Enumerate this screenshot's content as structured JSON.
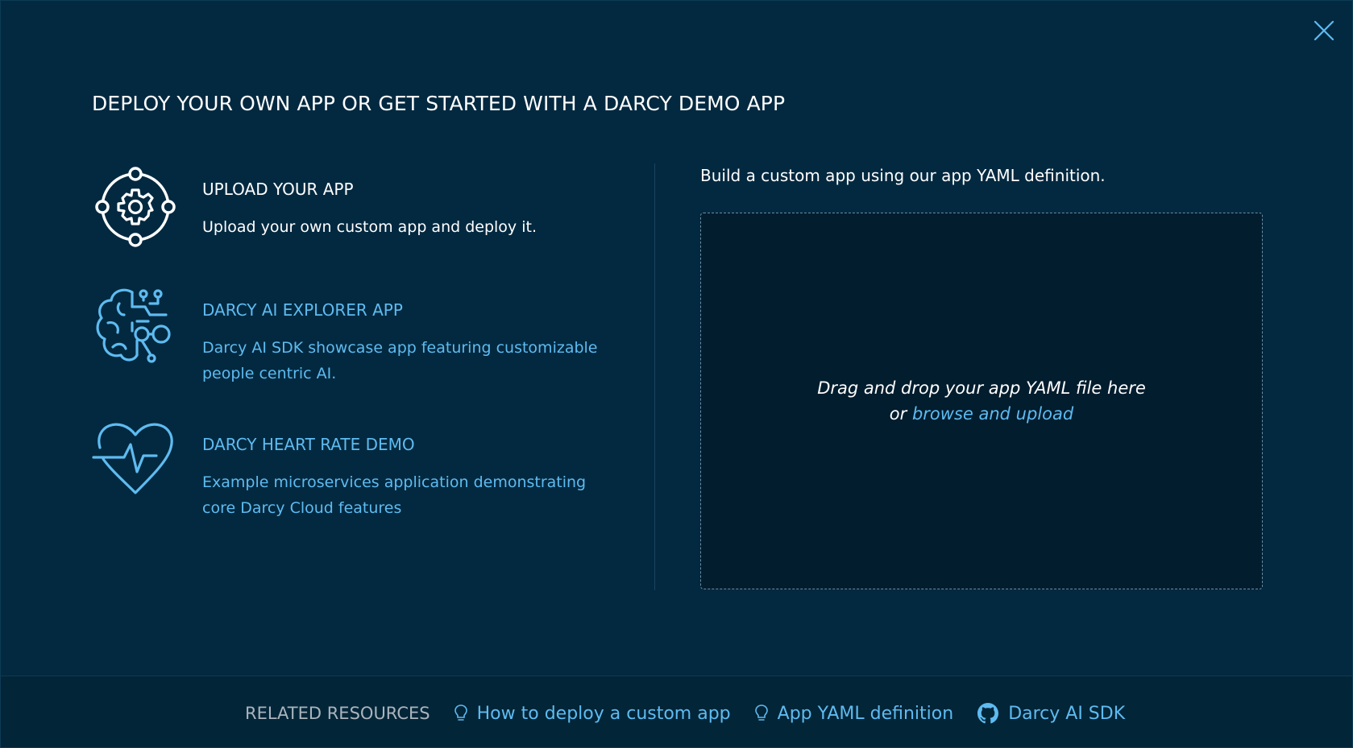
{
  "modal": {
    "title": "DEPLOY YOUR OWN APP OR GET STARTED WITH A DARCY DEMO APP",
    "close_icon": "close-icon"
  },
  "options": [
    {
      "icon": "gear-orbit-icon",
      "title": "UPLOAD YOUR APP",
      "description": "Upload your own custom app and deploy it."
    },
    {
      "icon": "brain-circuit-icon",
      "title": "DARCY AI EXPLORER APP",
      "description": "Darcy AI SDK showcase app featuring customizable people centric AI."
    },
    {
      "icon": "heart-rate-icon",
      "title": "DARCY HEART RATE DEMO",
      "description": "Example microservices application demonstrating core Darcy Cloud features"
    }
  ],
  "upload_panel": {
    "intro": "Build a custom app using our app YAML definition.",
    "dropzone_line1": "Drag and drop your app YAML file here",
    "dropzone_or": "or",
    "dropzone_link": "browse and upload"
  },
  "footer": {
    "label": "RELATED RESOURCES",
    "links": [
      {
        "icon": "lightbulb-icon",
        "label": "How to deploy a custom app"
      },
      {
        "icon": "lightbulb-icon",
        "label": "App YAML definition"
      },
      {
        "icon": "github-icon",
        "label": "Darcy AI SDK"
      }
    ]
  },
  "colors": {
    "background": "#032940",
    "accent": "#5ebbf0",
    "text": "#ffffff",
    "muted": "#aab4bd",
    "dropzone": "#021d2e"
  }
}
